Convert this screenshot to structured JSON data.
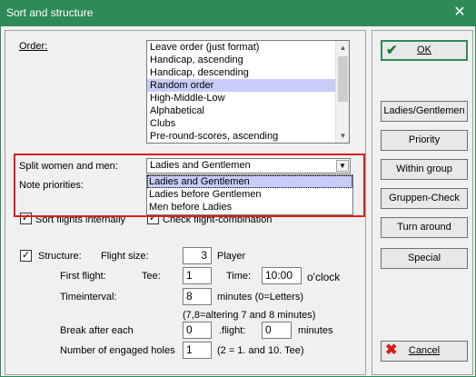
{
  "window": {
    "title": "Sort and structure",
    "close_symbol": "✕"
  },
  "order": {
    "label": "Order:",
    "options": [
      "Leave order (just format)",
      "Handicap, ascending",
      "Handicap, descending",
      "Random order",
      "High-Middle-Low",
      "Alphabetical",
      "Clubs",
      "Pre-round-scores, ascending"
    ],
    "selected": "Random order"
  },
  "split": {
    "label": "Split women and men:",
    "value": "Ladies and Gentlemen",
    "options": [
      "Ladies and Gentlemen",
      "Ladies before Gentlemen",
      "Men before Ladies"
    ],
    "selected": "Ladies and Gentlemen"
  },
  "note_priorities_label": "Note priorities:",
  "sort_flights": {
    "label": "Sort flights internally",
    "checked": true
  },
  "check_flight": {
    "label": "Check flight-combination",
    "checked": true
  },
  "structure": {
    "label": "Structure:",
    "checked": true,
    "flight_size_label": "Flight size:",
    "flight_size_value": "3",
    "player_label": "Player",
    "first_flight_label": "First flight:",
    "tee_label": "Tee:",
    "tee_value": "1",
    "time_label": "Time:",
    "time_value": "10:00",
    "oclock_label": "o'clock",
    "timeinterval_label": "Timeinterval:",
    "timeinterval_value": "8",
    "minutes_note": "minutes (0=Letters)",
    "altering_note": "(7,8=altering 7 and 8 minutes)",
    "break_label": "Break after each",
    "break_value": "0",
    "flight_label": ".flight:",
    "break_minutes_value": "0",
    "minutes_label": "minutes",
    "holes_label": "Number of engaged holes",
    "holes_value": "1",
    "holes_note": "(2 = 1. and 10. Tee)"
  },
  "buttons": {
    "ok": "OK",
    "ladies_gentlemen": "Ladies/Gentlemen",
    "priority": "Priority",
    "within_group": "Within group",
    "gruppen_check": "Gruppen-Check",
    "turn_around": "Turn around",
    "special": "Special",
    "cancel": "Cancel"
  },
  "colors": {
    "title_bar": "#2e8b57",
    "selection": "#c8ccf8",
    "highlight_box": "#e01a1a"
  }
}
